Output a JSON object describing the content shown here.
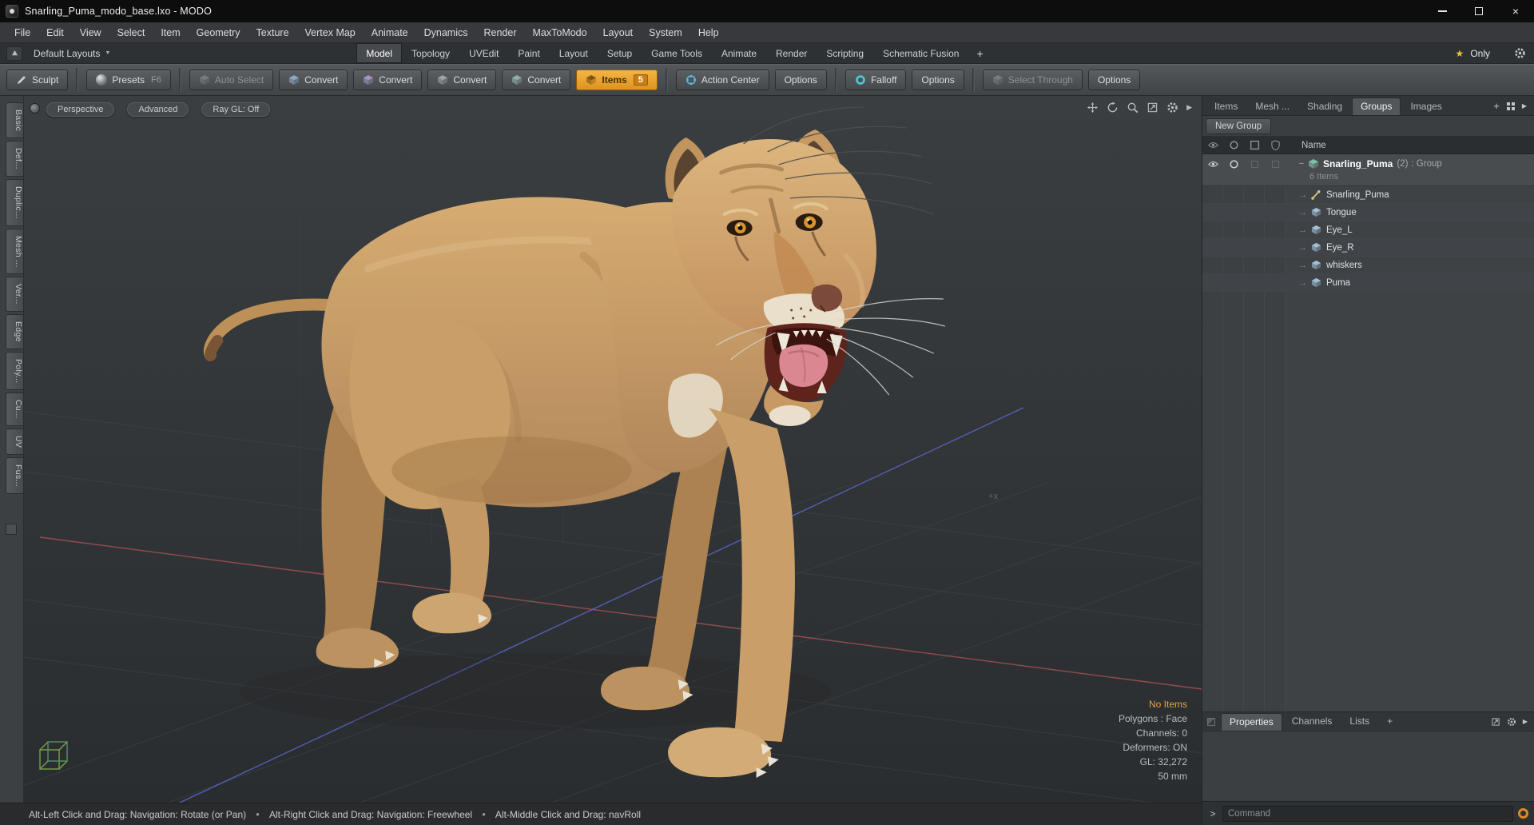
{
  "window": {
    "title": "Snarling_Puma_modo_base.lxo - MODO"
  },
  "icons": {
    "close": "×",
    "dropdown": "▼",
    "star": "★",
    "bullet": "●",
    "plus": "+",
    "tree_arrow": "→",
    "collapse": "−",
    "panel_arrow": "▶"
  },
  "menu": {
    "items": [
      "File",
      "Edit",
      "View",
      "Select",
      "Item",
      "Geometry",
      "Texture",
      "Vertex Map",
      "Animate",
      "Dynamics",
      "Render",
      "MaxToModo",
      "Layout",
      "System",
      "Help"
    ]
  },
  "layout_bar": {
    "dropdown_label": "Default Layouts",
    "tabs": [
      "Model",
      "Topology",
      "UVEdit",
      "Paint",
      "Layout",
      "Setup",
      "Game Tools",
      "Animate",
      "Render",
      "Scripting",
      "Schematic Fusion"
    ],
    "add_tab": "+",
    "only_label": "Only"
  },
  "toolbar": {
    "buttons": [
      {
        "label": "Sculpt"
      },
      {
        "label": "Presets",
        "shortcut": "F6"
      },
      {
        "label": "Auto Select"
      },
      {
        "label": "Convert"
      },
      {
        "label": "Convert"
      },
      {
        "label": "Convert"
      },
      {
        "label": "Convert"
      },
      {
        "label": "Items",
        "badge": "5"
      },
      {
        "label": "Action Center"
      },
      {
        "label": "Options"
      },
      {
        "label": "Falloff"
      },
      {
        "label": "Options"
      },
      {
        "label": "Select Through"
      },
      {
        "label": "Options"
      }
    ]
  },
  "left_tabs": {
    "items": [
      "Basic",
      "Def...",
      "Duplic...",
      "Mesh ...",
      "Ver...",
      "Edge",
      "Poly...",
      "Cu...",
      "UV",
      "Fus..."
    ]
  },
  "viewport": {
    "buttons": [
      "Perspective",
      "Advanced",
      "Ray GL: Off"
    ],
    "axis_label": "+x",
    "info": {
      "selection": "No Items",
      "lines": [
        "Polygons : Face",
        "Channels: 0",
        "Deformers: ON",
        "GL: 32,272",
        "50 mm"
      ]
    }
  },
  "right_panel": {
    "tabs": [
      "Items",
      "Mesh ...",
      "Shading",
      "Groups",
      "Images"
    ],
    "add_tab": "+",
    "new_group_label": "New Group",
    "name_header": "Name",
    "group_row": {
      "name": "Snarling_Puma",
      "count": "(2)",
      "type": ": Group",
      "items_count": "6 Items"
    },
    "children": [
      "Snarling_Puma",
      "Tongue",
      "Eye_L",
      "Eye_R",
      "whiskers",
      "Puma"
    ],
    "bottom_tabs": [
      "Properties",
      "Channels",
      "Lists"
    ],
    "bottom_add": "+",
    "command": {
      "prompt": ">",
      "placeholder": "Command"
    }
  },
  "status_bar": {
    "segments": [
      "Alt-Left Click and Drag: Navigation: Rotate (or Pan)",
      "Alt-Right Click and Drag: Navigation: Freewheel",
      "Alt-Middle Click and Drag: navRoll"
    ]
  },
  "colors": {
    "accent_orange": "#eda437",
    "info_highlight": "#e8a33d",
    "action_center_blue": "#58b8e8",
    "falloff_teal": "#4ec8d8"
  }
}
